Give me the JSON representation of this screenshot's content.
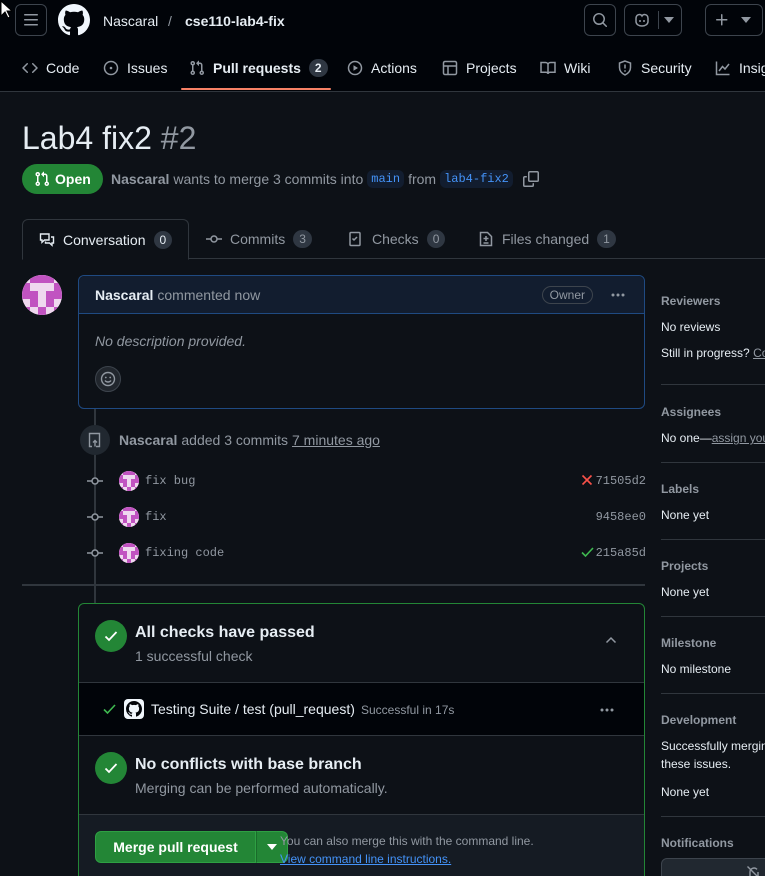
{
  "header": {
    "owner": "Nascaral",
    "separator": "/",
    "repo": "cse110-lab4-fix"
  },
  "nav": {
    "code": "Code",
    "issues": "Issues",
    "pulls": "Pull requests",
    "pulls_count": "2",
    "actions": "Actions",
    "projects": "Projects",
    "wiki": "Wiki",
    "security": "Security",
    "insights": "Insig"
  },
  "pr": {
    "title": "Lab4 fix2",
    "number": "#2",
    "state": "Open",
    "author": "Nascaral",
    "merge_text": "wants to merge 3 commits into",
    "base_branch": "main",
    "from_text": "from",
    "head_branch": "lab4-fix2"
  },
  "tabs": [
    {
      "label": "Conversation",
      "count": "0"
    },
    {
      "label": "Commits",
      "count": "3"
    },
    {
      "label": "Checks",
      "count": "0"
    },
    {
      "label": "Files changed",
      "count": "1"
    }
  ],
  "comment": {
    "author": "Nascaral",
    "action": "commented",
    "time": "now",
    "role": "Owner",
    "body": "No description provided."
  },
  "timeline": {
    "author": "Nascaral",
    "action": "added 3 commits",
    "time": "7 minutes ago",
    "commits": [
      {
        "message": "fix bug",
        "sha": "71505d2",
        "status": "fail"
      },
      {
        "message": "fix",
        "sha": "9458ee0",
        "status": "none"
      },
      {
        "message": "fixing code",
        "sha": "215a85d",
        "status": "pass"
      }
    ]
  },
  "merge": {
    "checks_title": "All checks have passed",
    "checks_sub": "1 successful check",
    "check_name": "Testing Suite / test (pull_request)",
    "check_status": "Successful in 17s",
    "conflicts_title": "No conflicts with base branch",
    "conflicts_sub": "Merging can be performed automatically.",
    "merge_button": "Merge pull request",
    "cli_text": "You can also merge this with the command line.",
    "cli_link": "View command line instructions."
  },
  "sidebar": {
    "reviewers_h": "Reviewers",
    "reviewers_v": "No reviews",
    "progress": "Still in progress?",
    "progress_link": "Co",
    "assignees_h": "Assignees",
    "assignees_v": "No one—",
    "assignees_link": "assign you",
    "labels_h": "Labels",
    "labels_v": "None yet",
    "projects_h": "Projects",
    "projects_v": "None yet",
    "milestone_h": "Milestone",
    "milestone_v": "No milestone",
    "development_h": "Development",
    "development_l1": "Successfully mergin",
    "development_l2": "these issues.",
    "development_v": "None yet",
    "notifications_h": "Notifications"
  },
  "colors": {
    "accent_green": "#238636",
    "link_blue": "#4493f8",
    "tab_underline": "#f78166",
    "fail_red": "#f85149"
  }
}
